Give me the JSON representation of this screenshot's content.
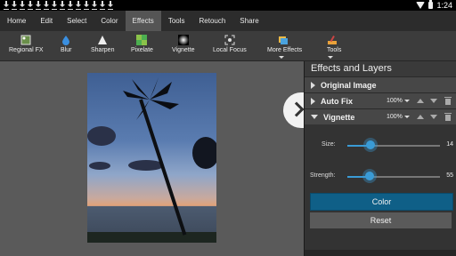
{
  "status_bar": {
    "time": "1:24",
    "download_icon_count": 14
  },
  "menu": {
    "items": [
      "Home",
      "Edit",
      "Select",
      "Color",
      "Effects",
      "Tools",
      "Retouch",
      "Share"
    ],
    "active": "Effects"
  },
  "toolbar": {
    "regional_fx": "Regional FX",
    "blur": "Blur",
    "sharpen": "Sharpen",
    "pixelate": "Pixelate",
    "vignette": "Vignette",
    "local_focus": "Local Focus",
    "more_effects": "More Effects",
    "tools": "Tools"
  },
  "panel": {
    "title": "Effects and Layers",
    "layers": [
      {
        "name": "Original Image"
      },
      {
        "name": "Auto Fix",
        "opacity": "100%"
      },
      {
        "name": "Vignette",
        "opacity": "100%",
        "expanded": true
      }
    ],
    "sliders": [
      {
        "label": "Size:",
        "value": "14",
        "fraction": 0.25
      },
      {
        "label": "Strength:",
        "value": "55",
        "fraction": 0.24
      }
    ],
    "color_button": "Color",
    "reset_button": "Reset"
  },
  "colors": {
    "accent": "#3a9bd6",
    "color_button": "#0f5f87",
    "menu_active": "#555555"
  }
}
